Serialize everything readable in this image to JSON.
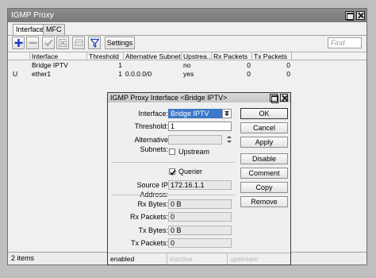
{
  "window": {
    "title": "IGMP Proxy"
  },
  "tabs": [
    {
      "label": "Interface"
    },
    {
      "label": "MFC"
    }
  ],
  "toolbar": {
    "settings_label": "Settings",
    "find_placeholder": "Find"
  },
  "table": {
    "columns": [
      "Interface",
      "Threshold",
      "Alternative Subnets",
      "Upstrea...",
      "Rx Packets",
      "Tx Packets"
    ],
    "rows": [
      {
        "flag": "",
        "interface": "Bridge IPTV",
        "threshold": "1",
        "alt_subnets": "",
        "upstream": "no",
        "rx_packets": "0",
        "tx_packets": "0"
      },
      {
        "flag": "U",
        "interface": "ether1",
        "threshold": "1",
        "alt_subnets": "0.0.0.0/0",
        "upstream": "yes",
        "rx_packets": "0",
        "tx_packets": "0"
      }
    ]
  },
  "status": {
    "items": "2 items"
  },
  "dialog": {
    "title": "IGMP Proxy Interface <Bridge IPTV>",
    "labels": {
      "interface": "Interface:",
      "threshold": "Threshold:",
      "alt_subnets": "Alternative Subnets:",
      "upstream": "Upstream",
      "querier": "Querier",
      "source_ip": "Source IP Address:",
      "rx_bytes": "Rx Bytes:",
      "rx_packets": "Rx Packets:",
      "tx_bytes": "Tx Bytes:",
      "tx_packets": "Tx Packets:"
    },
    "values": {
      "interface": "Bridge IPTV",
      "threshold": "1",
      "upstream_checked": false,
      "querier_checked": true,
      "source_ip": "172.16.1.1",
      "rx_bytes": "0 B",
      "rx_packets": "0",
      "tx_bytes": "0 B",
      "tx_packets": "0"
    },
    "buttons": {
      "ok": "OK",
      "cancel": "Cancel",
      "apply": "Apply",
      "disable": "Disable",
      "comment": "Comment",
      "copy": "Copy",
      "remove": "Remove"
    },
    "status": {
      "enabled": "enabled",
      "inactive": "inactive",
      "upstream": "upstream"
    }
  },
  "colors": {
    "title_bar": "#7f7f7f",
    "selection": "#3b78c8",
    "add_icon": "#1d3fbf"
  }
}
